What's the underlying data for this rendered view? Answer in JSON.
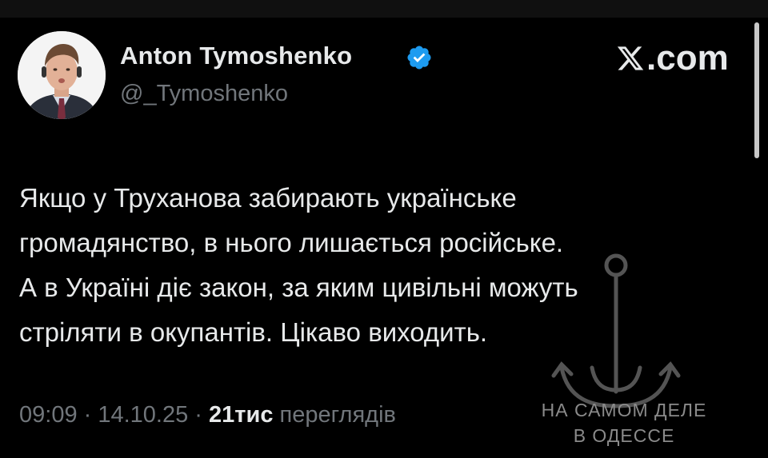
{
  "author": {
    "name": "Anton Tymoshenko",
    "handle": "@_Tymoshenko",
    "verified": true,
    "verified_color": "#1d9bf0"
  },
  "brand": {
    "label": ".com",
    "icon": "x-logo-icon"
  },
  "tweet": {
    "lines": [
      "Якщо у Труханова забирають українське",
      "громадянство, в нього лишається російське.",
      "А в Україні діє закон, за яким цивільні можуть",
      "стріляти в окупантів. Цікаво виходить."
    ]
  },
  "meta": {
    "time": "09:09",
    "separator": " · ",
    "date": "14.10.25",
    "views_count": "21тис",
    "views_label": "переглядів"
  },
  "watermark": {
    "line1": "НА САМОМ ДЕЛЕ",
    "line2": "В ОДЕССЕ",
    "icon": "anchor-icon"
  },
  "colors": {
    "background": "#000000",
    "text": "#e7e9ea",
    "secondary_text": "#71767b",
    "accent": "#1d9bf0"
  }
}
